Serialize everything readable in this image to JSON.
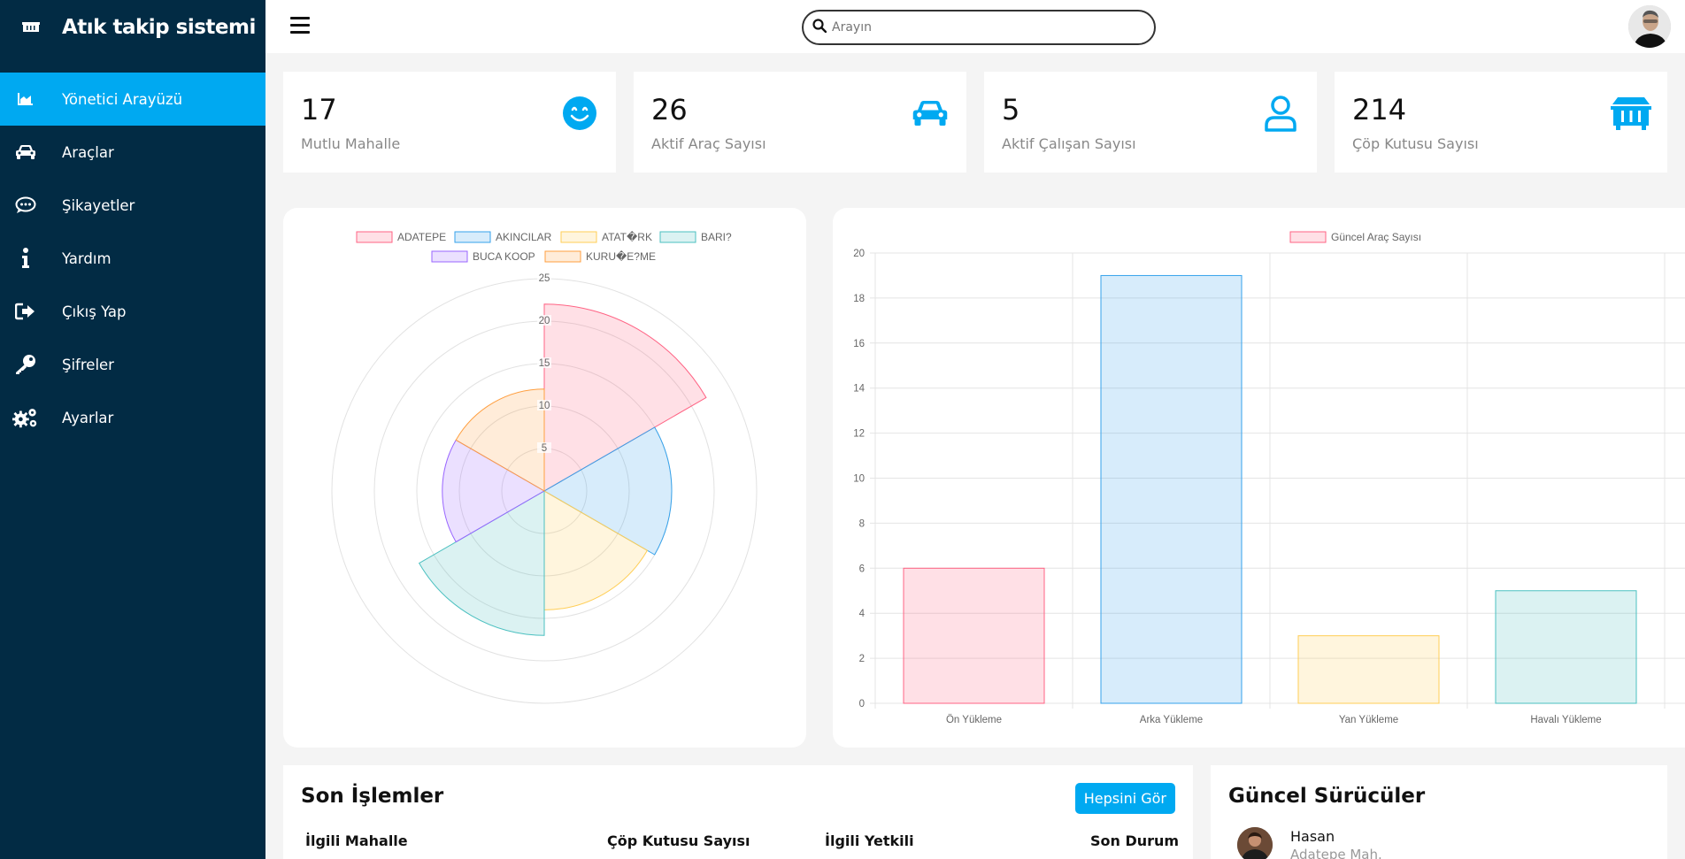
{
  "brand": {
    "title": "Atık takip sistemi"
  },
  "nav": [
    {
      "label": "Yönetici Arayüzü",
      "icon": "chart-area-icon",
      "active": true
    },
    {
      "label": "Araçlar",
      "icon": "car-icon"
    },
    {
      "label": "Şikayetler",
      "icon": "comments-icon"
    },
    {
      "label": "Yardım",
      "icon": "info-icon"
    },
    {
      "label": "Çıkış Yap",
      "icon": "sign-out-icon"
    },
    {
      "label": "Şifreler",
      "icon": "key-icon"
    },
    {
      "label": "Ayarlar",
      "icon": "cogs-icon"
    }
  ],
  "search": {
    "placeholder": "Arayın"
  },
  "stats": [
    {
      "value": "17",
      "label": "Mutlu Mahalle",
      "icon": "smile-icon"
    },
    {
      "value": "26",
      "label": "Aktif Araç Sayısı",
      "icon": "car-icon"
    },
    {
      "value": "5",
      "label": "Aktif Çalışan Sayısı",
      "icon": "user-icon"
    },
    {
      "value": "214",
      "label": "Çöp Kutusu Sayısı",
      "icon": "dumpster-icon"
    }
  ],
  "chart_data": [
    {
      "type": "polarArea",
      "labels": [
        "ADATEPE",
        "AKINCILAR",
        "ATAT�RK",
        "BARI?",
        "BUCA KOOP",
        "KURU�E?ME"
      ],
      "values": [
        22,
        15,
        14,
        17,
        12,
        12
      ],
      "rlim": [
        0,
        25
      ],
      "ticks": [
        "5",
        "10",
        "15",
        "20",
        "25"
      ],
      "legend": "top"
    },
    {
      "type": "bar",
      "categories": [
        "Ön Yükleme",
        "Arka Yükleme",
        "Yan Yükleme",
        "Havalı Yükleme"
      ],
      "series": [
        {
          "name": "Güncel Araç Sayısı",
          "values": [
            6,
            19,
            3,
            5
          ]
        }
      ],
      "ylim": [
        0,
        20
      ],
      "yticks": [
        "0",
        "2",
        "4",
        "6",
        "8",
        "10",
        "12",
        "14",
        "16",
        "18",
        "20"
      ],
      "grid": true,
      "legend": "top"
    }
  ],
  "colors": {
    "accent": "#00a9f1",
    "sidebar": "#022b44",
    "series_fill": [
      "rgba(255,99,132,0.2)",
      "rgba(54,162,235,0.2)",
      "rgba(255,206,86,0.2)",
      "rgba(75,192,192,0.2)",
      "rgba(153,102,255,0.2)",
      "rgba(255,159,64,0.2)"
    ],
    "series_stroke": [
      "#ff6384",
      "#36a2eb",
      "#ffce56",
      "#4bc0c0",
      "#9966ff",
      "#ff9f40"
    ]
  },
  "recent": {
    "title": "Son İşlemler",
    "see_all": "Hepsini Gör",
    "columns": [
      "İlgili Mahalle",
      "Çöp Kutusu Sayısı",
      "İlgili Yetkili",
      "Son Durum"
    ]
  },
  "drivers": {
    "title": "Güncel Sürücüler",
    "items": [
      {
        "name": "Hasan",
        "location": "Adatepe Mah."
      }
    ]
  }
}
